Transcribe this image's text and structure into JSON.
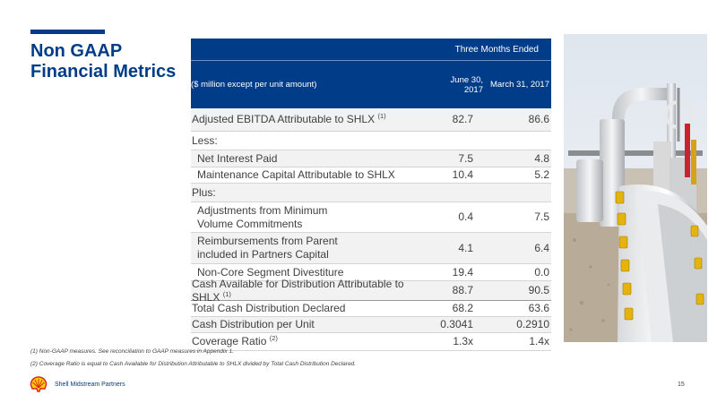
{
  "title": "Non GAAP Financial Metrics",
  "table": {
    "period_header": "Three Months Ended",
    "unit_note": "($ million except per unit amount)",
    "col_june": "June 30, 2017",
    "col_march": "March 31, 2017",
    "rows": [
      {
        "label": "Adjusted EBITDA Attributable to SHLX",
        "sup": "(1)",
        "june": "82.7",
        "march": "86.6"
      },
      {
        "label": "Less:",
        "sup": "",
        "june": "",
        "march": ""
      },
      {
        "label": "Net Interest Paid",
        "sup": "",
        "june": "7.5",
        "march": "4.8"
      },
      {
        "label": "Maintenance Capital Attributable to SHLX",
        "sup": "",
        "june": "10.4",
        "march": "5.2"
      },
      {
        "label": "Plus:",
        "sup": "",
        "june": "",
        "march": ""
      },
      {
        "label": "Adjustments from Minimum Volume Commitments",
        "sup": "",
        "june": "0.4",
        "march": "7.5"
      },
      {
        "label": "Reimbursements from Parent included in Partners Capital",
        "sup": "",
        "june": "4.1",
        "march": "6.4"
      },
      {
        "label": "Non-Core Segment Divestiture",
        "sup": "",
        "june": "19.4",
        "march": "0.0"
      },
      {
        "label": "Cash Available for Distribution Attributable to SHLX",
        "sup": "(1)",
        "june": "88.7",
        "march": "90.5"
      },
      {
        "label": "Total Cash Distribution Declared",
        "sup": "",
        "june": "68.2",
        "march": "63.6"
      },
      {
        "label": "Cash Distribution per Unit",
        "sup": "",
        "june": "0.3041",
        "march": "0.2910"
      },
      {
        "label": "Coverage Ratio",
        "sup": "(2)",
        "june": "1.3x",
        "march": "1.4x"
      }
    ]
  },
  "footnotes": [
    "(1) Non-GAAP measures.  See reconciliation to GAAP measures in Appendix 1.",
    "(2) Coverage Ratio is equal to Cash Available for Distribution Attributable to SHLX divided by Total Cash Distribution Declared."
  ],
  "brand": "Shell Midstream Partners",
  "page_number": "15",
  "colors": {
    "brand_blue": "#003c88",
    "shell_red": "#dd1d21",
    "shell_yellow": "#fbce07"
  },
  "icons": {
    "logo": "shell-logo-icon"
  }
}
